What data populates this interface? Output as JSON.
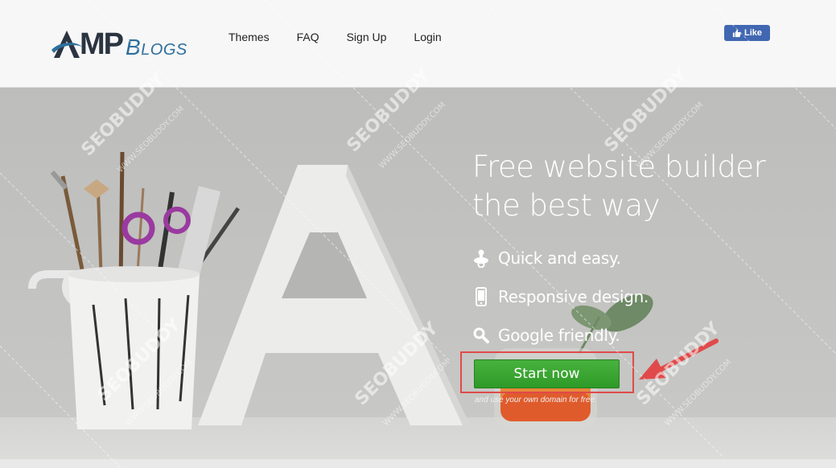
{
  "header": {
    "logo_main": "MP",
    "logo_sub": "Blogs",
    "nav": [
      "Themes",
      "FAQ",
      "Sign Up",
      "Login"
    ],
    "fb_like_label": "Like"
  },
  "hero": {
    "headline_line1": "Free website builder",
    "headline_line2": "the best way",
    "features": [
      {
        "icon": "pacifier-icon",
        "label": "Quick and easy."
      },
      {
        "icon": "mobile-phone-icon",
        "label": "Responsive design."
      },
      {
        "icon": "search-icon",
        "label": "Google friendly."
      }
    ],
    "cta_label": "Start now",
    "cta_sub": "and use your own domain for free"
  },
  "watermark": {
    "text": "SEOBUDDY",
    "url": "WWW.SEOBUDDY.COM"
  },
  "colors": {
    "cta_green": "#3aa832",
    "highlight_red": "#e04a4a",
    "logo_blue": "#2e6f9e",
    "fb_blue": "#4267b2"
  }
}
